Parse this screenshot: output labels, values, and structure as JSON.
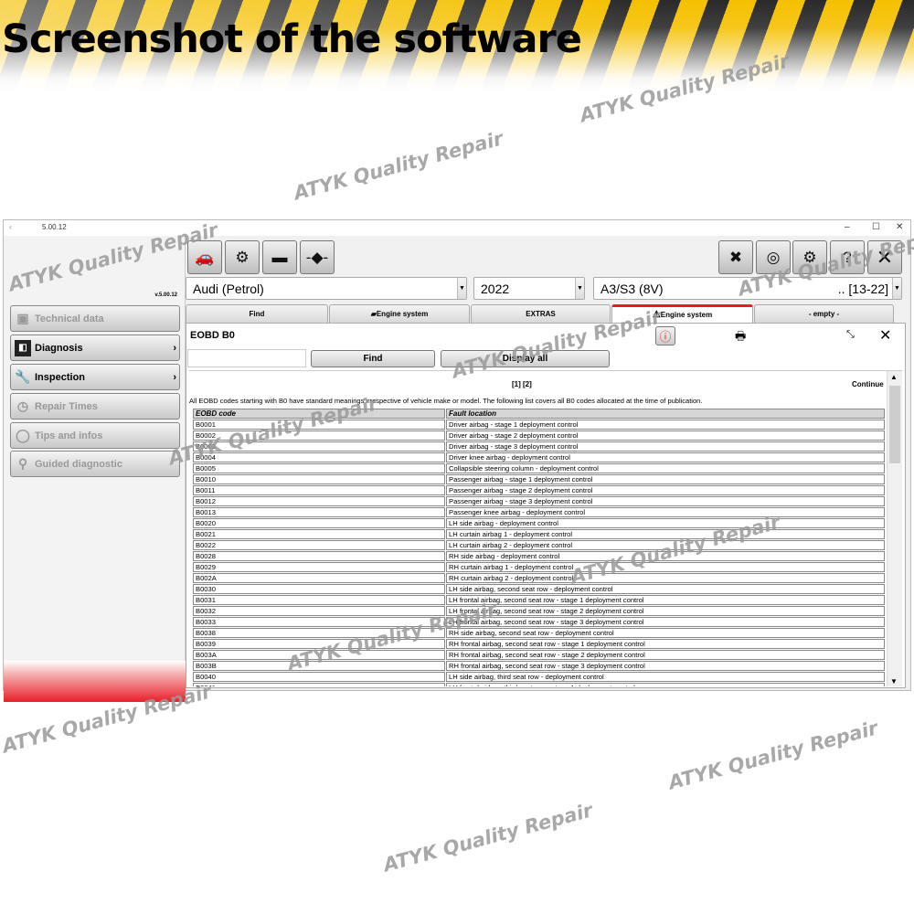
{
  "banner": {
    "title": "Screenshot of the software"
  },
  "watermark": "ATYK Quality Repair",
  "window": {
    "title": "5.00.12",
    "controls": {
      "minimize": "–",
      "maximize": "☐",
      "close": "✕"
    },
    "version": "v.5.00.12",
    "sidebar": [
      {
        "label": "Technical data",
        "icon": "document-icon",
        "enabled": false,
        "arrow": false
      },
      {
        "label": "Diagnosis",
        "icon": "diagnosis-icon",
        "enabled": true,
        "arrow": true
      },
      {
        "label": "Inspection",
        "icon": "wrench-icon",
        "enabled": true,
        "arrow": true
      },
      {
        "label": "Repair Times",
        "icon": "clock-icon",
        "enabled": false,
        "arrow": false
      },
      {
        "label": "Tips and infos",
        "icon": "lightbulb-icon",
        "enabled": false,
        "arrow": false
      },
      {
        "label": "Guided diagnostic",
        "icon": "magnifier-icon",
        "enabled": false,
        "arrow": false
      }
    ],
    "toolbar_left": [
      "cars-icon",
      "engine-icon",
      "battery-icon",
      "connector-icon"
    ],
    "toolbar_right": [
      "tools-icon",
      "tyre-icon",
      "gearbox-icon",
      "help-icon",
      "close-icon"
    ],
    "vehicle": {
      "make": "Audi (Petrol)",
      "year": "2022",
      "model": "A3/S3 (8V)",
      "model_range": ".. [13-22]"
    },
    "tabs": [
      {
        "label": "Find",
        "active": false
      },
      {
        "label": "Engine system",
        "active": false
      },
      {
        "label": "EXTRAS",
        "active": false
      },
      {
        "label": "Engine system",
        "active": true
      },
      {
        "label": "- empty -",
        "active": false
      }
    ],
    "panel": {
      "title": "EOBD B0",
      "search_value": "",
      "find_label": "Find",
      "display_all_label": "Display all",
      "pages": "[1] [2]",
      "continue_label": "Continue",
      "description": "All EOBD codes starting with B0 have standard meanings irrespective of vehicle make or model. The following list covers all B0 codes allocated at the time of publication.",
      "columns": [
        "EOBD code",
        "Fault location"
      ],
      "rows": [
        [
          "B0001",
          "Driver airbag - stage 1 deployment control"
        ],
        [
          "B0002",
          "Driver airbag - stage 2 deployment control"
        ],
        [
          "B0003",
          "Driver airbag - stage 3 deployment control"
        ],
        [
          "B0004",
          "Driver knee airbag - deployment control"
        ],
        [
          "B0005",
          "Collapsible steering column - deployment control"
        ],
        [
          "B0010",
          "Passenger airbag - stage 1 deployment control"
        ],
        [
          "B0011",
          "Passenger airbag - stage 2 deployment control"
        ],
        [
          "B0012",
          "Passenger airbag - stage 3 deployment control"
        ],
        [
          "B0013",
          "Passenger knee airbag - deployment control"
        ],
        [
          "B0020",
          "LH side airbag - deployment control"
        ],
        [
          "B0021",
          "LH curtain airbag 1 - deployment control"
        ],
        [
          "B0022",
          "LH curtain airbag 2 - deployment control"
        ],
        [
          "B0028",
          "RH side airbag - deployment control"
        ],
        [
          "B0029",
          "RH curtain airbag 1 - deployment control"
        ],
        [
          "B002A",
          "RH curtain airbag 2 - deployment control"
        ],
        [
          "B0030",
          "LH side airbag, second seat row - deployment control"
        ],
        [
          "B0031",
          "LH frontal airbag, second seat row - stage 1 deployment control"
        ],
        [
          "B0032",
          "LH frontal airbag, second seat row - stage 2 deployment control"
        ],
        [
          "B0033",
          "LH frontal airbag, second seat row - stage 3 deployment control"
        ],
        [
          "B0038",
          "RH side airbag, second seat row - deployment control"
        ],
        [
          "B0039",
          "RH frontal airbag, second seat row - stage 1 deployment control"
        ],
        [
          "B003A",
          "RH frontal airbag, second seat row - stage 2 deployment control"
        ],
        [
          "B003B",
          "RH frontal airbag, second seat row - stage 3 deployment control"
        ],
        [
          "B0040",
          "LH side airbag, third seat row - deployment control"
        ],
        [
          "B0041",
          "LH frontal airbag, third seat row - stage 1 deployment control"
        ]
      ]
    }
  },
  "colors": {
    "accent_red": "#e31b23",
    "stripe_yellow": "#f5c000",
    "stripe_black": "#2a2a2a"
  }
}
